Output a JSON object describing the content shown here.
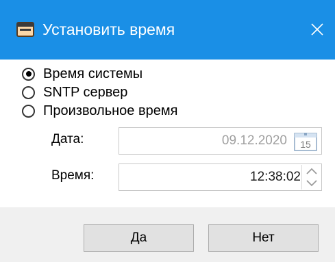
{
  "window": {
    "title": "Установить время",
    "icon": "window-app-icon",
    "close_icon": "close-icon"
  },
  "time_source": {
    "options": [
      {
        "label": "Время системы",
        "checked": true
      },
      {
        "label": "SNTP сервер",
        "checked": false
      },
      {
        "label": "Произвольное время",
        "checked": false
      }
    ]
  },
  "date": {
    "label": "Дата:",
    "value": "09.12.2020",
    "calendar_day": "15",
    "enabled": false
  },
  "time": {
    "label": "Время:",
    "value": "12:38:02"
  },
  "buttons": {
    "ok": "Да",
    "cancel": "Нет"
  },
  "colors": {
    "titlebar": "#1a8fe6",
    "footer": "#f0f0f0",
    "disabled_text": "#a0a0a0"
  }
}
